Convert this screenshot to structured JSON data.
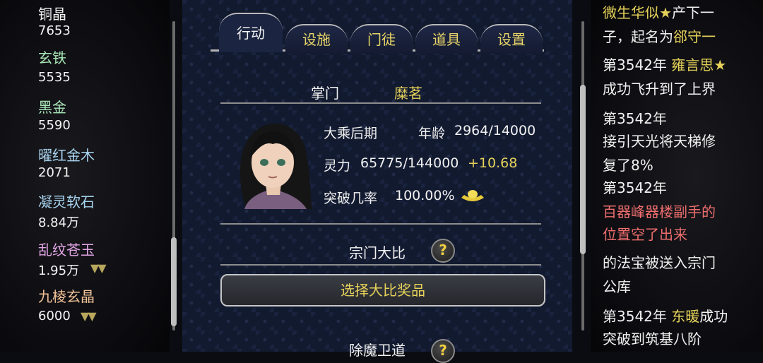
{
  "resources": [
    {
      "name": "铜晶",
      "value": "7653",
      "color": "#ffffff",
      "arrows": ""
    },
    {
      "name": "玄铁",
      "value": "5535",
      "color": "#a9e8b8",
      "arrows": ""
    },
    {
      "name": "黑金",
      "value": "5590",
      "color": "#a9e8b8",
      "arrows": ""
    },
    {
      "name": "曜红金木",
      "value": "2071",
      "color": "#a8d4f0",
      "arrows": ""
    },
    {
      "name": "凝灵软石",
      "value": "8.84万",
      "color": "#a8d4f0",
      "arrows": ""
    },
    {
      "name": "乱纹苍玉",
      "value": "1.95万",
      "color": "#e3a6e6",
      "arrows": "▼▼"
    },
    {
      "name": "九棱玄晶",
      "value": "6000",
      "color": "#f3c398",
      "arrows": "▼▼"
    }
  ],
  "tabs": [
    {
      "label": "行动",
      "active": true
    },
    {
      "label": "设施",
      "active": false
    },
    {
      "label": "门徒",
      "active": false
    },
    {
      "label": "道具",
      "active": false
    },
    {
      "label": "设置",
      "active": false
    }
  ],
  "sect_leader": {
    "title_label": "掌门",
    "name": "糜茗",
    "realm": "大乘后期",
    "age_label": "年龄",
    "age_value": "2964/14000",
    "spirit_label": "灵力",
    "spirit_value": "65775/144000",
    "spirit_gain": "+10.68",
    "breakthrough_label": "突破几率",
    "breakthrough_value": "100.00%"
  },
  "tournament": {
    "title": "宗门大比",
    "help": "?",
    "button_label": "选择大比奖品"
  },
  "next_section": {
    "title": "除魔卫道",
    "help": "?"
  },
  "events": [
    {
      "pre": "",
      "hl": "微生华似★",
      "post": "产下一"
    },
    {
      "pre": "子，起名为",
      "hl": "郤守一",
      "post": ""
    },
    {
      "pre": "第3542年 ",
      "hl": "雍言思★",
      "post": ""
    },
    {
      "pre": "成功飞升到了上界",
      "hl": "",
      "post": ""
    },
    {
      "pre": "第3542年",
      "hl": "",
      "post": ""
    },
    {
      "pre": "接引天光将天梯修",
      "hl": "",
      "post": ""
    },
    {
      "pre": "复了8%",
      "hl": "",
      "post": ""
    },
    {
      "pre": "第3542年",
      "hl": "",
      "post": ""
    },
    {
      "pre": "",
      "red": "百器峰器楼副手的"
    },
    {
      "pre": "",
      "red": "位置空了出来"
    },
    {
      "pre": "的法宝被送入宗门",
      "hl": "",
      "post": ""
    },
    {
      "pre": "公库",
      "hl": "",
      "post": ""
    },
    {
      "pre": "第3542年 ",
      "hl": "东暖",
      "post": "成功"
    },
    {
      "pre": "突破到筑基八阶",
      "hl": "",
      "post": ""
    }
  ]
}
